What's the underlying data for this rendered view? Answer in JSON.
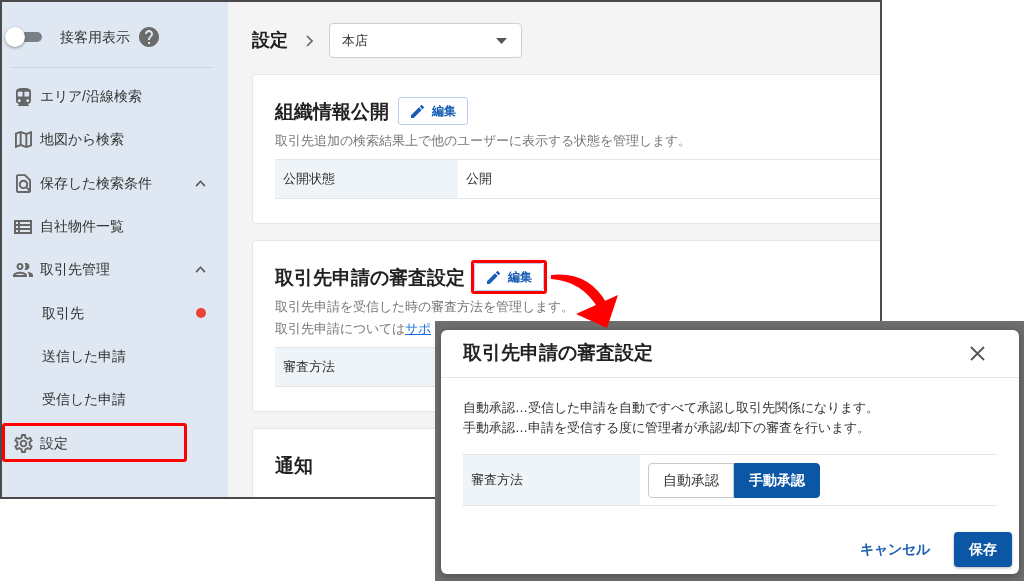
{
  "sidebar": {
    "customer_view": {
      "label": "接客用表示",
      "on": false
    },
    "items": [
      {
        "kind": "link",
        "label": "エリア/沿線検索",
        "highlighted": false
      },
      {
        "kind": "link",
        "label": "地図から検索",
        "highlighted": false
      },
      {
        "kind": "group",
        "label": "保存した検索条件",
        "expanded": true,
        "highlighted": false
      },
      {
        "kind": "link",
        "label": "自社物件一覧",
        "highlighted": false
      },
      {
        "kind": "group",
        "label": "取引先管理",
        "expanded": true,
        "highlighted": false,
        "children": [
          {
            "label": "取引先",
            "notification": true,
            "highlighted": false
          },
          {
            "label": "送信した申請",
            "notification": false,
            "highlighted": false
          },
          {
            "label": "受信した申請",
            "notification": false,
            "highlighted": false
          }
        ]
      },
      {
        "kind": "link",
        "label": "設定",
        "highlighted": true
      }
    ]
  },
  "header": {
    "title": "設定",
    "branch_select": {
      "value": "本店"
    }
  },
  "cards": [
    {
      "title": "組織情報公開",
      "edit_button": {
        "label": "編集",
        "highlighted": false
      },
      "description": [
        {
          "text": "取引先追加の検索結果上で他のユーザーに表示する状態を管理します。"
        }
      ],
      "rows": [
        {
          "label": "公開状態",
          "value": "公開"
        }
      ]
    },
    {
      "title": "取引先申請の審査設定",
      "edit_button": {
        "label": "編集",
        "highlighted": true
      },
      "description": [
        {
          "text": "取引先申請を受信した時の審査方法を管理します。"
        },
        {
          "text": "取引先申請については",
          "link": "サポ"
        }
      ],
      "rows": [
        {
          "label": "審査方法"
        }
      ]
    },
    {
      "title": "通知"
    }
  ],
  "dialog": {
    "title": "取引先申請の審査設定",
    "description": [
      "自動承認…受信した申請を自動ですべて承認し取引先関係になります。",
      "手動承認…申請を受信する度に管理者が承認/却下の審査を行います。"
    ],
    "rows": [
      {
        "label": "審査方法",
        "options": [
          {
            "label": "自動承認",
            "selected": false
          },
          {
            "label": "手動承認",
            "selected": true
          }
        ]
      }
    ],
    "buttons": [
      {
        "kind": "text",
        "label": "キャンセル"
      },
      {
        "kind": "primary",
        "label": "保存"
      }
    ]
  }
}
